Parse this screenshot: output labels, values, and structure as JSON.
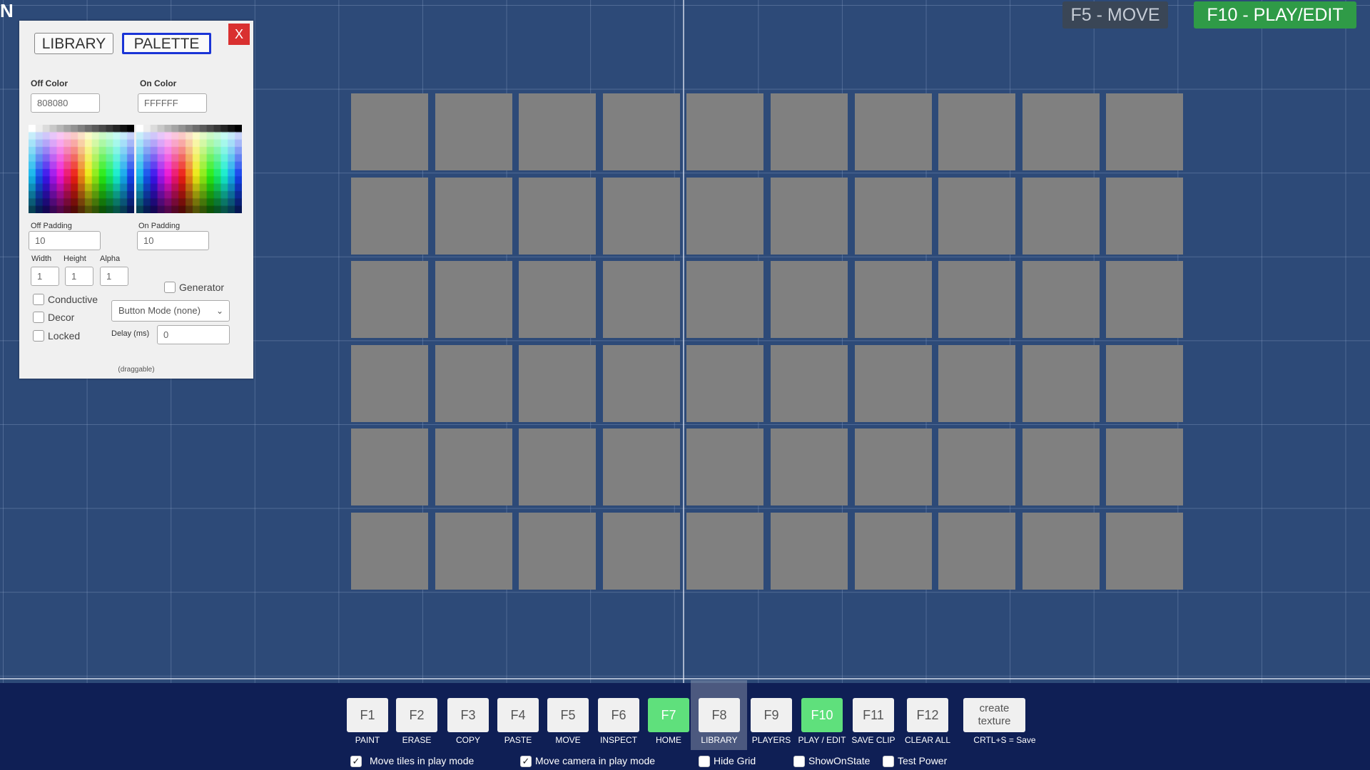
{
  "compass_label": "N",
  "top_buttons": {
    "move": "F5 - MOVE",
    "play_edit": "F10 - PLAY/EDIT"
  },
  "tile_grid": {
    "rows": 6,
    "cols": 10,
    "tile_color": "#808080"
  },
  "panel": {
    "tabs": {
      "library": "LIBRARY",
      "palette": "PALETTE"
    },
    "close": "X",
    "off_color_label": "Off Color",
    "off_color_value": "808080",
    "on_color_label": "On Color",
    "on_color_value": "FFFFFF",
    "off_padding_label": "Off Padding",
    "off_padding_value": "10",
    "on_padding_label": "On Padding",
    "on_padding_value": "10",
    "width_label": "Width",
    "width_value": "1",
    "height_label": "Height",
    "height_value": "1",
    "alpha_label": "Alpha",
    "alpha_value": "1",
    "generator_label": "Generator",
    "conductive_label": "Conductive",
    "decor_label": "Decor",
    "locked_label": "Locked",
    "button_mode": "Button Mode (none)",
    "delay_label": "Delay (ms)",
    "delay_value": "0",
    "draggable_note": "(draggable)"
  },
  "toolbar": {
    "keys": [
      {
        "key": "F1",
        "label": "PAINT",
        "active": false
      },
      {
        "key": "F2",
        "label": "ERASE",
        "active": false
      },
      {
        "key": "F3",
        "label": "COPY",
        "active": false
      },
      {
        "key": "F4",
        "label": "PASTE",
        "active": false
      },
      {
        "key": "F5",
        "label": "MOVE",
        "active": false
      },
      {
        "key": "F6",
        "label": "INSPECT",
        "active": false
      },
      {
        "key": "F7",
        "label": "HOME",
        "active": true
      },
      {
        "key": "F8",
        "label": "LIBRARY",
        "active": false,
        "highlighted": true
      },
      {
        "key": "F9",
        "label": "PLAYERS",
        "active": false
      },
      {
        "key": "F10",
        "label": "PLAY / EDIT",
        "active": true
      },
      {
        "key": "F11",
        "label": "SAVE CLIP",
        "active": false
      },
      {
        "key": "F12",
        "label": "CLEAR ALL",
        "active": false
      }
    ],
    "create_texture": "create texture",
    "save_hint": "CRTL+S = Save"
  },
  "options": {
    "move_tiles": {
      "label": "Move tiles in play mode",
      "checked": true
    },
    "move_camera": {
      "label": "Move camera in play mode",
      "checked": true
    },
    "hide_grid": {
      "label": "Hide Grid",
      "checked": false
    },
    "show_on_state": {
      "label": "ShowOnState",
      "checked": false
    },
    "test_power": {
      "label": "Test Power",
      "checked": false
    }
  },
  "colors": {
    "canvas_bg": "#2d4a78",
    "bottom_bar": "#0f1f55",
    "green_active": "#5fe07c",
    "palette_tab_border": "#1a34d6",
    "close_red": "#d93030"
  }
}
